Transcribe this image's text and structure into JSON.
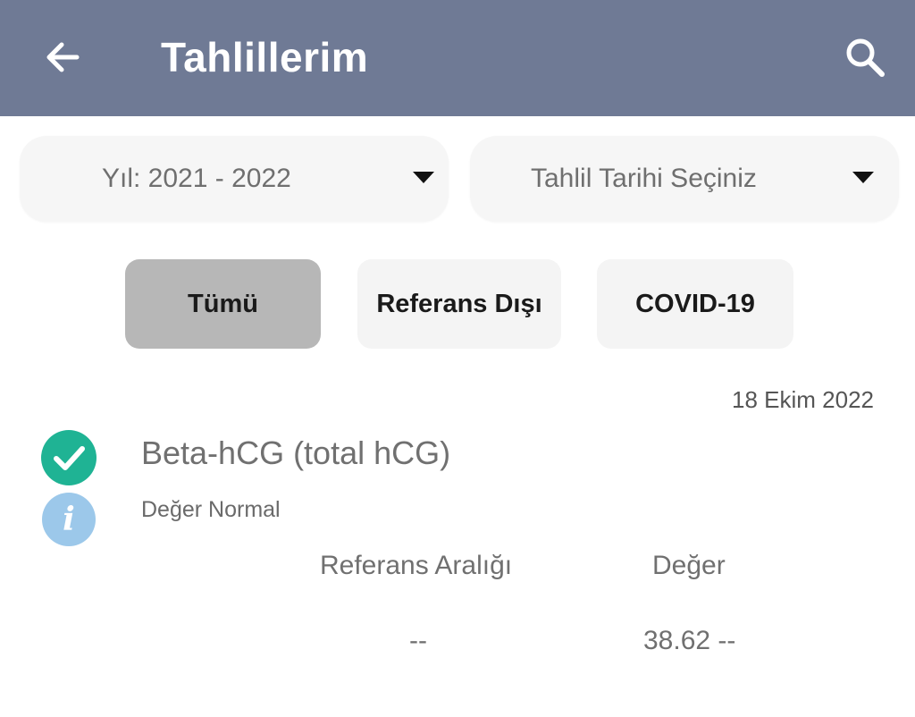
{
  "header": {
    "title": "Tahlillerim",
    "back_icon": "arrow-left-icon",
    "search_icon": "search-icon",
    "background": "#6f7a95"
  },
  "filters": {
    "year": {
      "label": "Yıl: 2021 - 2022",
      "icon": "caret-down-icon"
    },
    "date": {
      "label": "Tahlil Tarihi Seçiniz",
      "icon": "caret-down-icon"
    }
  },
  "chips": [
    {
      "label": "Tümü",
      "selected": true
    },
    {
      "label": "Referans Dışı",
      "selected": false
    },
    {
      "label": "COVID-19",
      "selected": false
    }
  ],
  "results": {
    "date": "18 Ekim 2022",
    "test": {
      "name": "Beta-hCG (total hCG)",
      "status": "Değer Normal",
      "status_icon": "check-circle-icon",
      "status_color": "#1fb394",
      "info_icon": "info-icon",
      "info_glyph": "i",
      "columns": {
        "reference": "Referans Aralığı",
        "value": "Değer"
      },
      "reference_range": "--",
      "value": "38.62 --"
    }
  }
}
